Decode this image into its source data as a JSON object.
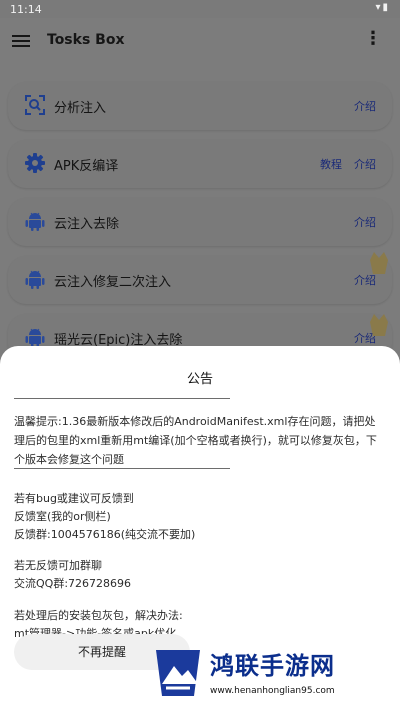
{
  "status_bar": {
    "time": "11:14"
  },
  "app_bar": {
    "title": "Tosks Box"
  },
  "list": {
    "items": [
      {
        "label": "分析注入",
        "links": [
          "介绍"
        ]
      },
      {
        "label": "APK反编译",
        "links": [
          "教程",
          "介绍"
        ]
      },
      {
        "label": "云注入去除",
        "links": [
          "介绍"
        ]
      },
      {
        "label": "云注入修复二次注入",
        "links": [
          "介绍"
        ]
      },
      {
        "label": "瑶光云(Epic)注入去除",
        "links": [
          "介绍"
        ]
      }
    ]
  },
  "announcement": {
    "title": "公告",
    "warning": "温馨提示:1.36最新版本修改后的AndroidManifest.xml存在问题，请把处理后的包里的xml重新用mt编译(加个空格或者换行)，就可以修复灰包，下个版本会修复这个问题",
    "feedback_lines": [
      "若有bug或建议可反馈到",
      "反馈室(我的or侧栏)",
      "反馈群:1004576186(纯交流不要加)"
    ],
    "group_lines": [
      "若无反馈可加群聊",
      "交流QQ群:726728696"
    ],
    "fix_lines": [
      "若处理后的安装包灰包，解决办法:",
      "mt管理器->功能-签名或apk优化"
    ],
    "dismiss_label": "不再提醒"
  },
  "watermark": {
    "name": "鸿联手游网",
    "url": "www.henanhonglian95.com"
  },
  "colors": {
    "accent": "#1a2a78",
    "icon_blue": "#1f3f8f",
    "android_blue": "#2a4a9a"
  }
}
